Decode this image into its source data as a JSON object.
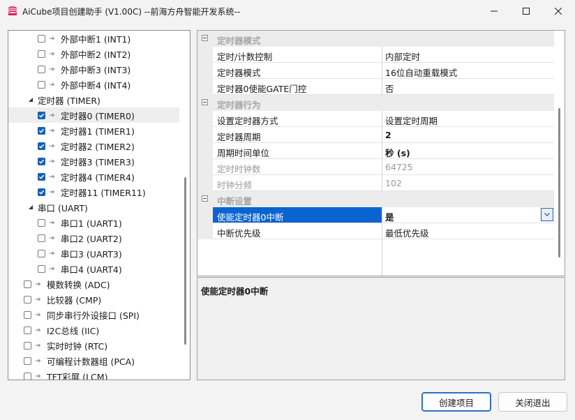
{
  "window": {
    "title": "AiCube项目创建助手 (V1.00C) --前海方舟智能开发系统--",
    "controls": [
      "minimize-icon",
      "maximize-icon",
      "close-icon"
    ]
  },
  "tree": {
    "items": [
      {
        "label": "外部中断1 (INT1)",
        "level": 2,
        "checked": false
      },
      {
        "label": "外部中断2 (INT2)",
        "level": 2,
        "checked": false
      },
      {
        "label": "外部中断3 (INT3)",
        "level": 2,
        "checked": false
      },
      {
        "label": "外部中断4 (INT4)",
        "level": 2,
        "checked": false
      },
      {
        "label": "定时器 (TIMER)",
        "level": 1,
        "group": true,
        "expanded": true
      },
      {
        "label": "定时器0 (TIMER0)",
        "level": 2,
        "checked": true,
        "selected": true
      },
      {
        "label": "定时器1 (TIMER1)",
        "level": 2,
        "checked": true
      },
      {
        "label": "定时器2 (TIMER2)",
        "level": 2,
        "checked": true
      },
      {
        "label": "定时器3 (TIMER3)",
        "level": 2,
        "checked": true
      },
      {
        "label": "定时器4 (TIMER4)",
        "level": 2,
        "checked": true
      },
      {
        "label": "定时器11 (TIMER11)",
        "level": 2,
        "checked": true
      },
      {
        "label": "串口 (UART)",
        "level": 1,
        "group": true,
        "expanded": true
      },
      {
        "label": "串口1 (UART1)",
        "level": 2,
        "checked": false
      },
      {
        "label": "串口2 (UART2)",
        "level": 2,
        "checked": false
      },
      {
        "label": "串口3 (UART3)",
        "level": 2,
        "checked": false
      },
      {
        "label": "串口4 (UART4)",
        "level": 2,
        "checked": false
      },
      {
        "label": "模数转换 (ADC)",
        "level": 1,
        "checked": false
      },
      {
        "label": "比较器 (CMP)",
        "level": 1,
        "checked": false
      },
      {
        "label": "同步串行外设接口 (SPI)",
        "level": 1,
        "checked": false
      },
      {
        "label": "I2C总线 (IIC)",
        "level": 1,
        "checked": false
      },
      {
        "label": "实时时钟 (RTC)",
        "level": 1,
        "checked": false
      },
      {
        "label": "可编程计数器组 (PCA)",
        "level": 1,
        "checked": false
      },
      {
        "label": "TFT彩屏 (LCM)",
        "level": 1,
        "checked": false
      }
    ]
  },
  "property_grid": {
    "categories": [
      {
        "label": "定时器模式",
        "rows": [
          {
            "name": "定时/计数控制",
            "value": "内部定时"
          },
          {
            "name": "定时器模式",
            "value": "16位自动重载模式"
          },
          {
            "name": "定时器0使能GATE门控",
            "value": "否"
          }
        ]
      },
      {
        "label": "定时器行为",
        "rows": [
          {
            "name": "设置定时器方式",
            "value": "设置定时周期"
          },
          {
            "name": "定时器周期",
            "value": "2",
            "bold": true
          },
          {
            "name": "周期时间单位",
            "value": "秒 (s)",
            "bold": true
          },
          {
            "name": "定时时钟数",
            "value": "64725",
            "disabled": true
          },
          {
            "name": "时钟分频",
            "value": "102",
            "disabled": true
          }
        ]
      },
      {
        "label": "中断设置",
        "rows": [
          {
            "name": "使能定时器0中断",
            "value": "是",
            "bold": true,
            "selected": true,
            "dropdown": true
          },
          {
            "name": "中断优先级",
            "value": "最低优先级"
          }
        ]
      }
    ]
  },
  "description": {
    "title": "使能定时器0中断"
  },
  "buttons": {
    "create": "创建项目",
    "exit": "关闭退出"
  },
  "colors": {
    "checkbox_checked": "#1a5fb4",
    "selection": "#0a64d0",
    "category_text": "#a6a6a6",
    "disabled_text": "#9a9a9a"
  }
}
